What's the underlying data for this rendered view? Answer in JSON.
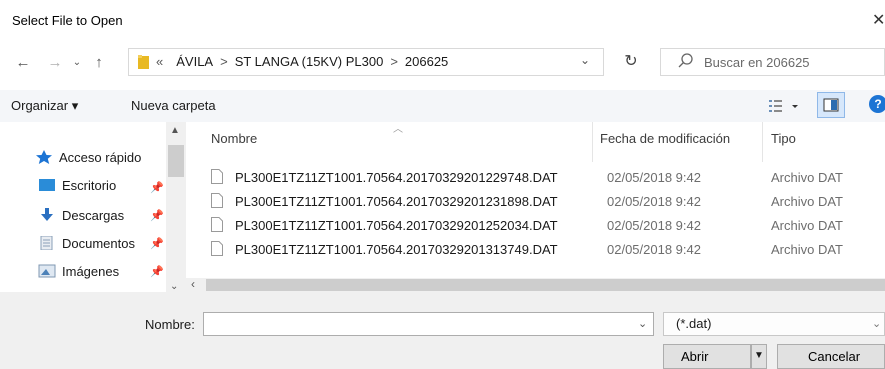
{
  "window": {
    "title": "Select File to Open",
    "close_icon": "close-icon"
  },
  "address": {
    "overflow": "«",
    "crumbs": [
      "ÁVILA",
      "ST LANGA (15KV) PL300",
      "206625"
    ],
    "separator": ">"
  },
  "search": {
    "placeholder": "Buscar en 206625"
  },
  "toolbar": {
    "organize": "Organizar ▾",
    "new_folder": "Nueva carpeta",
    "help": "?"
  },
  "nav": {
    "items": [
      {
        "label": "Acceso rápido",
        "icon": "star-icon"
      },
      {
        "label": "Escritorio",
        "icon": "desktop-icon",
        "pinned": true
      },
      {
        "label": "Descargas",
        "icon": "download-icon",
        "pinned": true
      },
      {
        "label": "Documentos",
        "icon": "document-icon",
        "pinned": true
      },
      {
        "label": "Imágenes",
        "icon": "pictures-icon",
        "pinned": true
      }
    ]
  },
  "columns": {
    "name": "Nombre",
    "modified": "Fecha de modificación",
    "type": "Tipo"
  },
  "files": [
    {
      "name": "PL300E1TZ11ZT1001.70564.20170329201229748.DAT",
      "modified": "02/05/2018 9:42",
      "type": "Archivo DAT"
    },
    {
      "name": "PL300E1TZ11ZT1001.70564.20170329201231898.DAT",
      "modified": "02/05/2018 9:42",
      "type": "Archivo DAT"
    },
    {
      "name": "PL300E1TZ11ZT1001.70564.20170329201252034.DAT",
      "modified": "02/05/2018 9:42",
      "type": "Archivo DAT"
    },
    {
      "name": "PL300E1TZ11ZT1001.70564.20170329201313749.DAT",
      "modified": "02/05/2018 9:42",
      "type": "Archivo DAT"
    }
  ],
  "footer": {
    "name_label": "Nombre:",
    "name_value": "",
    "filter": "(*.dat)",
    "open": "Abrir",
    "cancel": "Cancelar"
  },
  "colors": {
    "accent": "#1c74d4",
    "folder": "#e8b923",
    "toolbar_bg": "#f4f6f9",
    "footer_bg": "#f0f0f0"
  }
}
